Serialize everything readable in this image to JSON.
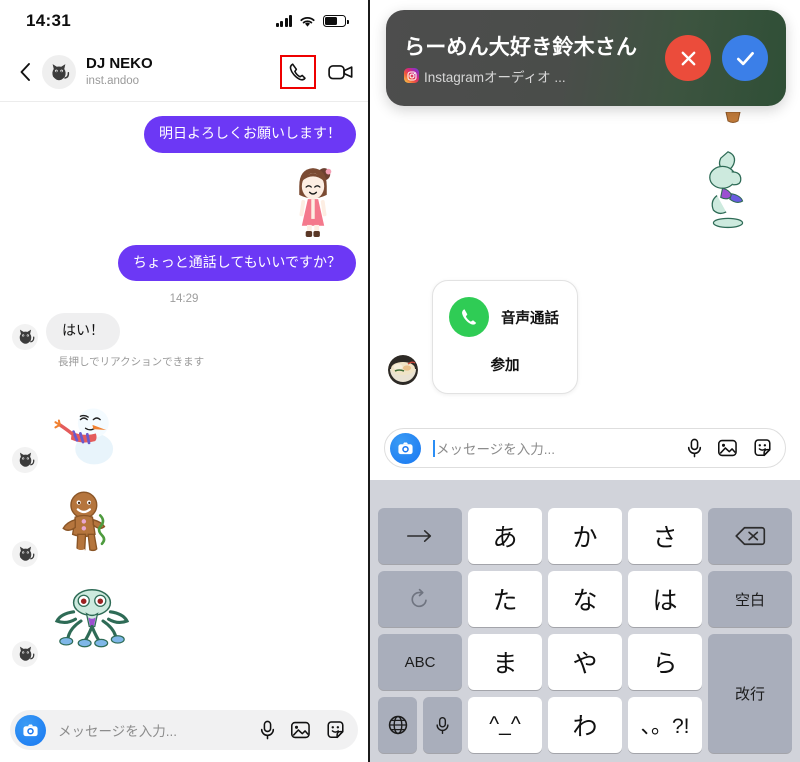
{
  "left_phone": {
    "status_bar": {
      "time": "14:31",
      "icons": [
        "signal-bars-icon",
        "wifi-icon",
        "battery-icon"
      ]
    },
    "chat_header": {
      "back_icon": "back-chevron-icon",
      "avatar": "cat-avatar",
      "title": "DJ NEKO",
      "subtitle": "inst.andoo",
      "audio_call_icon": "phone-call-icon",
      "video_call_icon": "video-camera-icon",
      "highlight_color": "#ee0000"
    },
    "messages": [
      {
        "id": "m1",
        "side": "outgoing",
        "type": "text",
        "text": "明日よろしくお願いします！"
      },
      {
        "id": "m2",
        "side": "outgoing",
        "type": "sticker",
        "sticker": "girl-standing-sticker"
      },
      {
        "id": "m3",
        "side": "outgoing",
        "type": "text",
        "text": "ちょっと通話してもいいですか？"
      },
      {
        "id": "t1",
        "type": "timestamp",
        "text": "14:29"
      },
      {
        "id": "m4",
        "side": "incoming",
        "type": "text",
        "text": "はい！",
        "hint": "長押しでリアクションできます"
      },
      {
        "id": "m5",
        "side": "incoming",
        "type": "sticker",
        "sticker": "snowman-sticker"
      },
      {
        "id": "m6",
        "side": "incoming",
        "type": "sticker",
        "sticker": "gingerbread-man-sticker"
      },
      {
        "id": "m7",
        "side": "incoming",
        "type": "sticker",
        "sticker": "squid-character-sticker"
      }
    ],
    "composer": {
      "camera_icon": "camera-icon",
      "placeholder": "メッセージを入力...",
      "mic_icon": "microphone-icon",
      "gallery_icon": "photo-gallery-icon",
      "sticker_icon": "sticker-icon"
    },
    "bubble_color_out": "#6c38f5",
    "bubble_color_in": "#efeff0"
  },
  "right_phone": {
    "notification_banner": {
      "title": "らーめん大好き鈴木さん",
      "app_icon": "instagram-icon",
      "subtitle": "Instagramオーディオ ...",
      "decline_icon": "close-x-icon",
      "accept_icon": "checkmark-icon",
      "decline_color": "#eb4c3b",
      "accept_color": "#3b7fe8"
    },
    "peek_sticker": "squid-character-sticker",
    "call_card": {
      "phone_icon": "phone-call-icon",
      "label": "音声通話",
      "join_label": "参加",
      "icon_color": "#2fcc55"
    },
    "sender_avatar": "ramen-bowl-avatar",
    "composer": {
      "camera_icon": "camera-icon",
      "placeholder": "メッセージを入力...",
      "mic_icon": "microphone-icon",
      "gallery_icon": "photo-gallery-icon",
      "sticker_icon": "sticker-icon"
    },
    "keyboard": {
      "background": "#d1d3da",
      "rows": [
        {
          "keys": [
            {
              "label": "→",
              "type": "function",
              "name": "cursor-right-key"
            },
            {
              "label": "あ",
              "type": "char",
              "name": "key-a"
            },
            {
              "label": "か",
              "type": "char",
              "name": "key-ka"
            },
            {
              "label": "さ",
              "type": "char",
              "name": "key-sa"
            },
            {
              "label": "⌫",
              "type": "function",
              "name": "backspace-key"
            }
          ]
        },
        {
          "keys": [
            {
              "label": "↺",
              "type": "function",
              "name": "undo-key"
            },
            {
              "label": "た",
              "type": "char",
              "name": "key-ta"
            },
            {
              "label": "な",
              "type": "char",
              "name": "key-na"
            },
            {
              "label": "は",
              "type": "char",
              "name": "key-ha"
            },
            {
              "label": "空白",
              "type": "function",
              "name": "space-key"
            }
          ]
        },
        {
          "keys": [
            {
              "label": "ABC",
              "type": "function",
              "name": "abc-key"
            },
            {
              "label": "ま",
              "type": "char",
              "name": "key-ma"
            },
            {
              "label": "や",
              "type": "char",
              "name": "key-ya"
            },
            {
              "label": "ら",
              "type": "char",
              "name": "key-ra"
            },
            {
              "label": "改行",
              "type": "function",
              "name": "return-key"
            }
          ]
        },
        {
          "keys": [
            {
              "label": "🌐",
              "type": "function",
              "name": "globe-key"
            },
            {
              "label": "🎤",
              "type": "function",
              "name": "dictation-key"
            },
            {
              "label": "^_^",
              "type": "char",
              "name": "key-emoticon"
            },
            {
              "label": "わ",
              "type": "char",
              "name": "key-wa"
            },
            {
              "label": "、。?!",
              "type": "char",
              "name": "key-punctuation"
            }
          ]
        }
      ]
    }
  }
}
